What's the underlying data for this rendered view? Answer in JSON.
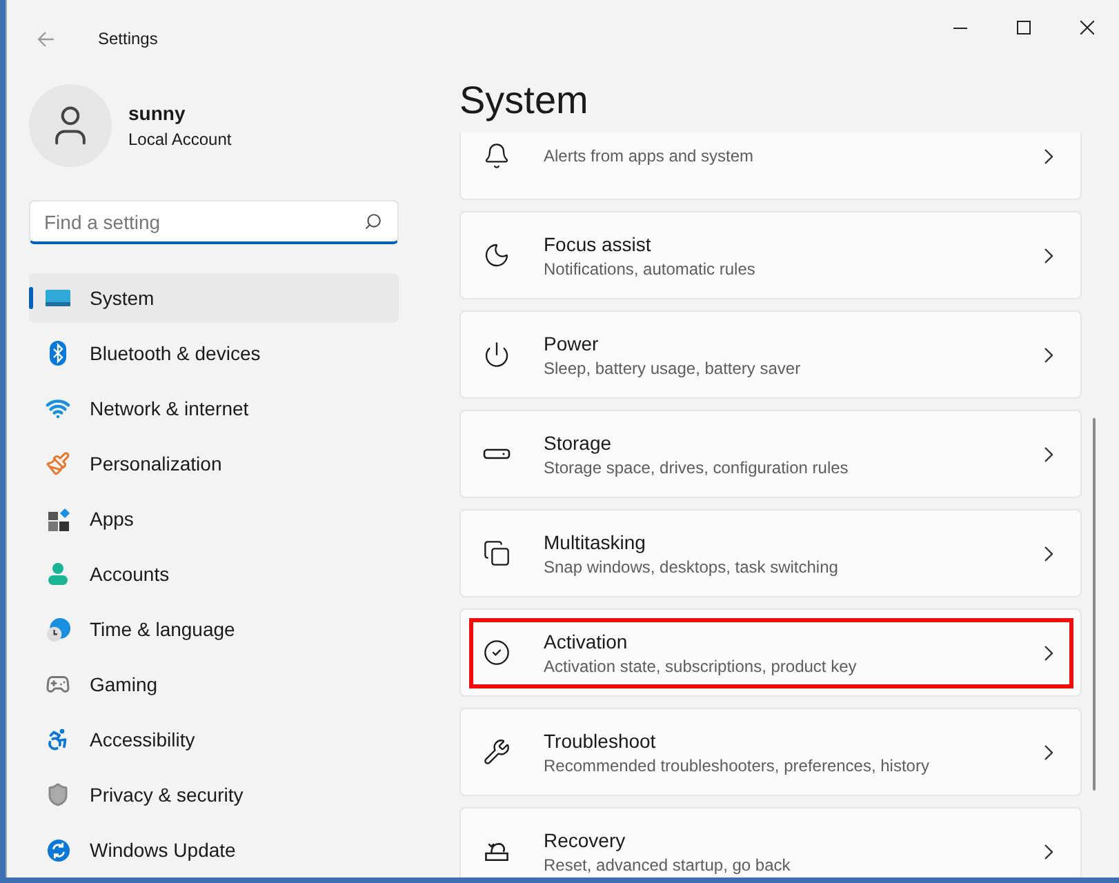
{
  "window": {
    "title": "Settings"
  },
  "account": {
    "name": "sunny",
    "type": "Local Account"
  },
  "search": {
    "placeholder": "Find a setting"
  },
  "sidebar": {
    "items": [
      {
        "label": "System",
        "selected": true
      },
      {
        "label": "Bluetooth & devices",
        "selected": false
      },
      {
        "label": "Network & internet",
        "selected": false
      },
      {
        "label": "Personalization",
        "selected": false
      },
      {
        "label": "Apps",
        "selected": false
      },
      {
        "label": "Accounts",
        "selected": false
      },
      {
        "label": "Time & language",
        "selected": false
      },
      {
        "label": "Gaming",
        "selected": false
      },
      {
        "label": "Accessibility",
        "selected": false
      },
      {
        "label": "Privacy & security",
        "selected": false
      },
      {
        "label": "Windows Update",
        "selected": false
      }
    ]
  },
  "page": {
    "title": "System"
  },
  "cards": [
    {
      "description": "Alerts from apps and system",
      "highlighted": false
    },
    {
      "title": "Focus assist",
      "description": "Notifications, automatic rules",
      "highlighted": false
    },
    {
      "title": "Power",
      "description": "Sleep, battery usage, battery saver",
      "highlighted": false
    },
    {
      "title": "Storage",
      "description": "Storage space, drives, configuration rules",
      "highlighted": false
    },
    {
      "title": "Multitasking",
      "description": "Snap windows, desktops, task switching",
      "highlighted": false
    },
    {
      "title": "Activation",
      "description": "Activation state, subscriptions, product key",
      "highlighted": true
    },
    {
      "title": "Troubleshoot",
      "description": "Recommended troubleshooters, preferences, history",
      "highlighted": false
    },
    {
      "title": "Recovery",
      "description": "Reset, advanced startup, go back",
      "highlighted": false
    }
  ]
}
